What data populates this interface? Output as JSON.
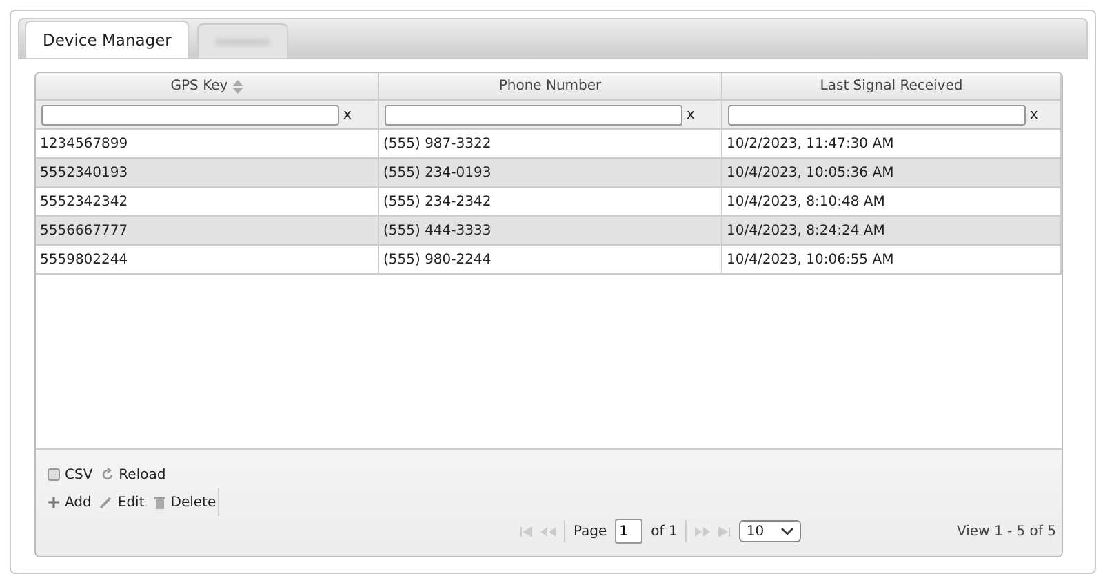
{
  "tabs": [
    {
      "label": "Device Manager",
      "selected": true,
      "blurred": false
    },
    {
      "selected": false,
      "blurred": true
    }
  ],
  "table": {
    "columns": [
      {
        "label": "GPS Key",
        "sortable": true
      },
      {
        "label": "Phone Number",
        "sortable": false
      },
      {
        "label": "Last Signal Received",
        "sortable": false
      }
    ],
    "filter_clear": [
      "x",
      "x",
      "x"
    ],
    "rows": [
      {
        "cells": [
          "1234567899",
          "(555) 987-3322",
          "10/2/2023, 11:47:30 AM"
        ],
        "shaded": false
      },
      {
        "cells": [
          "5552340193",
          "(555) 234-0193",
          "10/4/2023, 10:05:36 AM"
        ],
        "shaded": true
      },
      {
        "cells": [
          "5552342342",
          "(555) 234-2342",
          "10/4/2023, 8:10:48 AM"
        ],
        "shaded": false
      },
      {
        "cells": [
          "5556667777",
          "(555) 444-3333",
          "10/4/2023, 8:24:24 AM"
        ],
        "shaded": true
      },
      {
        "cells": [
          "5559802244",
          "(555) 980-2244",
          "10/4/2023, 10:06:55 AM"
        ],
        "shaded": false
      }
    ]
  },
  "toolbar": [
    [
      {
        "label": "CSV",
        "kind": "csv"
      },
      {
        "label": "Reload",
        "kind": "reload"
      }
    ],
    [
      {
        "label": "Add",
        "kind": "add"
      },
      {
        "label": "Edit",
        "kind": "edit"
      },
      {
        "label": "Delete",
        "kind": "delete"
      }
    ]
  ],
  "pager": {
    "page_label": "Page",
    "page": "1",
    "of_label": "of 1",
    "page_size": "10",
    "summary": "View 1 - 5 of 5"
  }
}
